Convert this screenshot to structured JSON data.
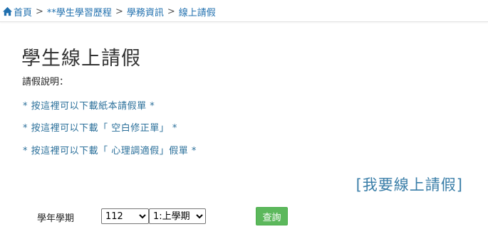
{
  "breadcrumb": {
    "home": "首頁",
    "separator": ">",
    "items": [
      "**學生學習歷程",
      "學務資訊",
      "線上請假"
    ]
  },
  "page": {
    "title": "學生線上請假",
    "notice_label": "請假說明："
  },
  "links": {
    "paper_form": "* 按這裡可以下載紙本請假單 *",
    "correction_form": "* 按這裡可以下載「 空白修正單」 *",
    "mental_health_form": "* 按這裡可以下載「 心理調適假」假單 *",
    "apply_online": "[我要線上請假]"
  },
  "filter": {
    "year_label": "學年學期",
    "year_value": "112",
    "term_value": "1:上學期",
    "query_label": "查詢"
  },
  "colors": {
    "link": "#2a6f9a",
    "breadcrumb": "#1f6fae",
    "button": "#5cb85c"
  }
}
